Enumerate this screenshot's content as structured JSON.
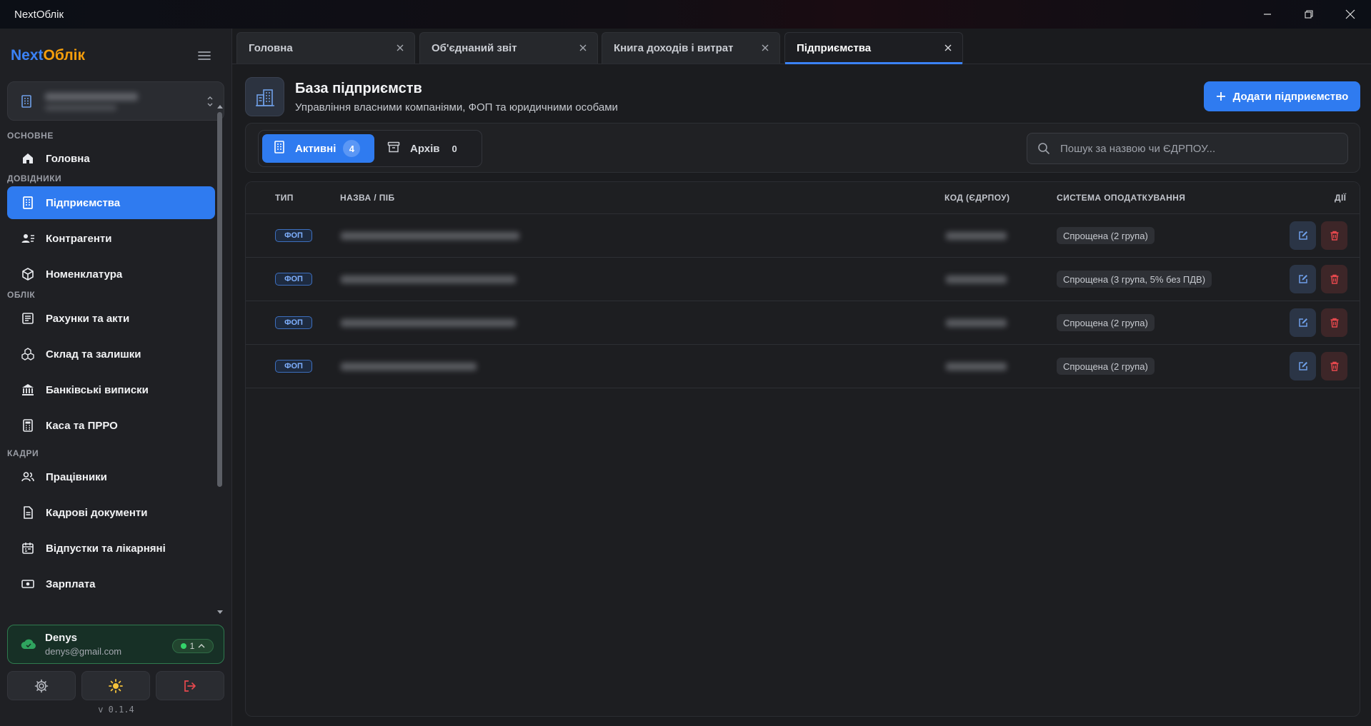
{
  "window": {
    "title": "NextОблік"
  },
  "sidebar": {
    "logo": {
      "part1": "Next",
      "part2": "Облік"
    },
    "sections": {
      "main": "ОСНОВНЕ",
      "directories": "ДОВІДНИКИ",
      "accounting": "ОБЛІК",
      "hr": "КАДРИ"
    },
    "items": [
      {
        "label": "Головна",
        "icon": "home-icon"
      },
      {
        "label": "Підприємства",
        "icon": "building-icon",
        "active": true
      },
      {
        "label": "Контрагенти",
        "icon": "contacts-icon"
      },
      {
        "label": "Номенклатура",
        "icon": "box-icon"
      },
      {
        "label": "Рахунки та акти",
        "icon": "invoice-icon"
      },
      {
        "label": "Склад та залишки",
        "icon": "boxes-icon"
      },
      {
        "label": "Банківські виписки",
        "icon": "bank-icon"
      },
      {
        "label": "Каса та ПРРО",
        "icon": "calculator-icon"
      },
      {
        "label": "Працівники",
        "icon": "users-icon"
      },
      {
        "label": "Кадрові документи",
        "icon": "document-icon"
      },
      {
        "label": "Відпустки та лікарняні",
        "icon": "calendar-icon"
      },
      {
        "label": "Зарплата",
        "icon": "money-icon"
      }
    ],
    "user": {
      "name": "Denys",
      "email": "denys@gmail.com",
      "sync_count": "1"
    },
    "version": "v 0.1.4"
  },
  "tabs": [
    {
      "label": "Головна"
    },
    {
      "label": "Об'єднаний звіт"
    },
    {
      "label": "Книга доходів і витрат"
    },
    {
      "label": "Підприємства",
      "active": true
    }
  ],
  "page": {
    "title": "База підприємств",
    "subtitle": "Управління власними компаніями, ФОП та юридичними особами",
    "add_button": "Додати підприємство"
  },
  "filters": {
    "active_label": "Активні",
    "active_count": "4",
    "archive_label": "Архів",
    "archive_count": "0",
    "search_placeholder": "Пошук за назвою чи ЄДРПОУ..."
  },
  "table": {
    "headers": {
      "type": "ТИП",
      "name": "НАЗВА / ПІБ",
      "code": "КОД (ЄДРПОУ)",
      "tax": "СИСТЕМА ОПОДАТКУВАННЯ",
      "actions": "ДІЇ"
    },
    "rows": [
      {
        "type": "ФОП",
        "tax": "Спрощена (2 група)"
      },
      {
        "type": "ФОП",
        "tax": "Спрощена (3 група, 5% без ПДВ)"
      },
      {
        "type": "ФОП",
        "tax": "Спрощена (2 група)"
      },
      {
        "type": "ФОП",
        "tax": "Спрощена (2 група)"
      }
    ]
  },
  "colors": {
    "accent": "#2f7bf0",
    "logo_orange": "#f59e0b",
    "danger": "#e5484d",
    "success": "#34d36a"
  }
}
